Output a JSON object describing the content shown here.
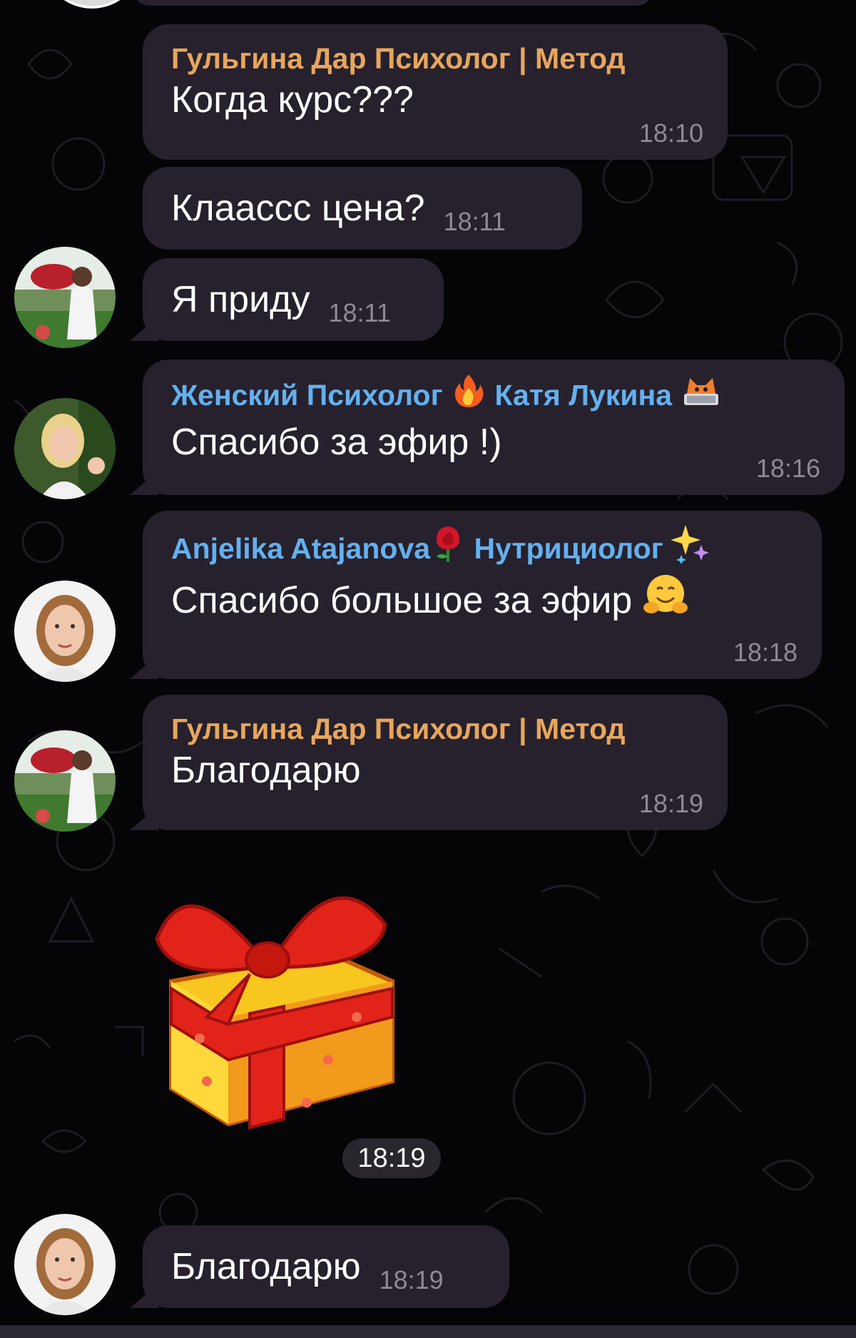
{
  "colors": {
    "background": "#050507",
    "bubble": "#26212d",
    "sender_orange": "#e8a65c",
    "sender_blue": "#64b0ee",
    "time": "#8d8a93"
  },
  "messages": [
    {
      "sender": "Гульгина Дар Психолог | Метод",
      "text": "Когда курс???",
      "time": "18:10"
    },
    {
      "text": "Клааccc цена?",
      "time": "18:11"
    },
    {
      "text": "Я приду",
      "time": "18:11"
    },
    {
      "sender": "Женский Психолог",
      "sender_emoji": "fire-emoji",
      "sender_suffix": "Катя Лукина",
      "sender_emoji_2": "cat-laptop-emoji",
      "text": "Спасибо за эфир !)",
      "time": "18:16"
    },
    {
      "sender": "Anjelika Atajanova",
      "sender_emoji": "rose-emoji",
      "sender_suffix": "Нутрициолог",
      "sender_emoji_2": "sparkles-emoji",
      "text": "Спасибо большое за эфир",
      "text_emoji": "hugging-face-emoji",
      "time": "18:18"
    },
    {
      "sender": "Гульгина Дар Психолог | Метод",
      "text": "Благодарю",
      "time": "18:19"
    },
    {
      "sticker": "gift-box-sticker",
      "time": "18:19"
    },
    {
      "text": "Благодарю",
      "time": "18:19"
    }
  ]
}
